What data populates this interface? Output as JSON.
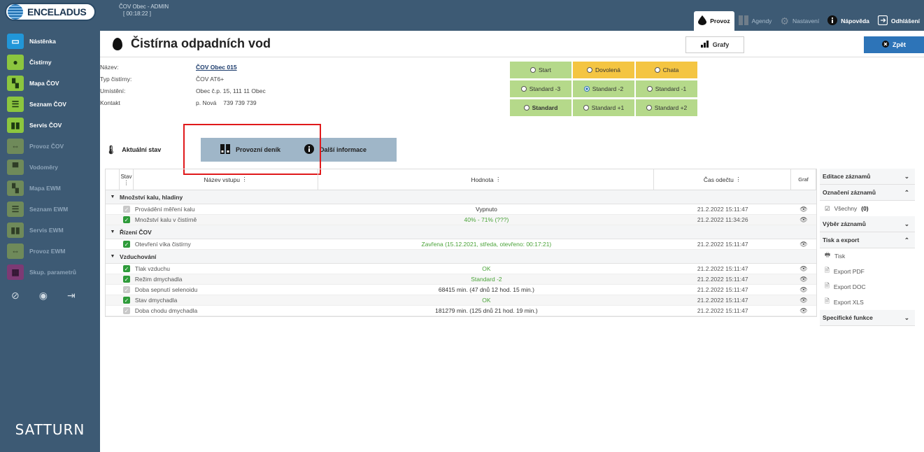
{
  "header": {
    "logo_text": "ENCELADUS",
    "session_title": "ČOV Obec - ADMIN",
    "session_timer": "[ 00:18:22 ]",
    "nav": [
      {
        "label": "Provoz",
        "icon": "drop-icon"
      },
      {
        "label": "Agendy",
        "icon": "binders-icon"
      },
      {
        "label": "Nastavení",
        "icon": "gear-icon"
      },
      {
        "label": "Nápověda",
        "icon": "info-icon"
      },
      {
        "label": "Odhlášení",
        "icon": "logout-icon"
      }
    ]
  },
  "sidebar": {
    "items": [
      {
        "label": "Nástěnka",
        "icon": "monitor-icon"
      },
      {
        "label": "Čistírny",
        "icon": "drop-icon"
      },
      {
        "label": "Mapa ČOV",
        "icon": "map-icon"
      },
      {
        "label": "Seznam ČOV",
        "icon": "list-icon"
      },
      {
        "label": "Servis ČOV",
        "icon": "binders-icon"
      },
      {
        "label": "Provoz ČOV",
        "icon": "arrows-icon"
      },
      {
        "label": "Vodoměry",
        "icon": "meter-icon"
      },
      {
        "label": "Mapa EWM",
        "icon": "map-icon"
      },
      {
        "label": "Seznam EWM",
        "icon": "list-icon"
      },
      {
        "label": "Servis EWM",
        "icon": "binders-icon"
      },
      {
        "label": "Provoz EWM",
        "icon": "arrows-icon"
      },
      {
        "label": "Skup. parametrů",
        "icon": "grid-icon"
      }
    ],
    "brand": "SATTURN"
  },
  "page": {
    "title": "Čistírna odpadních vod",
    "grafy_label": "Grafy",
    "back_label": "Zpět"
  },
  "info": {
    "name_label": "Název:",
    "name_value": "ČOV Obec 015",
    "type_label": "Typ čistírny:",
    "type_value": "ČOV AT6+",
    "location_label": "Umístění:",
    "location_value": "Obec č.p. 15, 111 11 Obec",
    "contact_label": "Kontakt",
    "contact_name": "p. Nová",
    "contact_phone": "739 739 739"
  },
  "modes": [
    {
      "label": "Start",
      "color": "#b5d98a"
    },
    {
      "label": "Dovolená",
      "color": "#f4c542"
    },
    {
      "label": "Chata",
      "color": "#f4c542"
    },
    {
      "label": "Standard -3",
      "color": "#b5d98a"
    },
    {
      "label": "Standard -2",
      "color": "#b5d98a",
      "selected": true
    },
    {
      "label": "Standard -1",
      "color": "#b5d98a"
    },
    {
      "label": "Standard",
      "color": "#b5d98a",
      "bold": true
    },
    {
      "label": "Standard +1",
      "color": "#b5d98a"
    },
    {
      "label": "Standard +2",
      "color": "#b5d98a"
    }
  ],
  "tabs": [
    {
      "label": "Aktuální stav"
    },
    {
      "label": "Provozní deník"
    },
    {
      "label": "Další informace"
    }
  ],
  "table": {
    "headers": {
      "stav": "Stav",
      "name": "Název vstupu",
      "value": "Hodnota",
      "time": "Čas odečtu",
      "graph": "Graf"
    },
    "groups": [
      {
        "label": "Množství kalu, hladiny",
        "rows": [
          {
            "checked": false,
            "name": "Provádění měření kalu",
            "value": "Vypnuto",
            "value_color": "dark",
            "time": "21.2.2022 15:11:47"
          },
          {
            "checked": true,
            "name": "Množství kalu v čistírně",
            "value": "40% - 71% (???)",
            "value_color": "green",
            "time": "21.2.2022 11:34:26"
          }
        ]
      },
      {
        "label": "Řízení ČOV",
        "rows": [
          {
            "checked": true,
            "name": "Otevření víka čistírny",
            "value": "Zavřena (15.12.2021, středa, otevřeno: 00:17:21)",
            "value_color": "green",
            "time": "21.2.2022 15:11:47"
          }
        ]
      },
      {
        "label": "Vzduchování",
        "rows": [
          {
            "checked": true,
            "name": "Tlak vzduchu",
            "value": "OK",
            "value_color": "green",
            "time": "21.2.2022 15:11:47"
          },
          {
            "checked": true,
            "name": "Režim dmychadla",
            "value": "Standard -2",
            "value_color": "green",
            "time": "21.2.2022 15:11:47"
          },
          {
            "checked": false,
            "name": "Doba sepnutí selenoidu",
            "value": "68415 min. (47 dnů 12 hod. 15 min.)",
            "value_color": "dark",
            "time": "21.2.2022 15:11:47"
          },
          {
            "checked": true,
            "name": "Stav dmychadla",
            "value": "OK",
            "value_color": "green",
            "time": "21.2.2022 15:11:47"
          },
          {
            "checked": false,
            "name": "Doba chodu dmychadla",
            "value": "181279 min. (125 dnů 21 hod. 19 min.)",
            "value_color": "dark",
            "time": "21.2.2022 15:11:47"
          }
        ]
      }
    ]
  },
  "right_panel": {
    "sections": [
      {
        "label": "Editace záznamů",
        "expanded": false
      },
      {
        "label": "Označení záznamů",
        "expanded": true,
        "items": [
          {
            "label": "Všechny",
            "count": "(0)"
          }
        ]
      },
      {
        "label": "Výběr záznamů",
        "expanded": false
      },
      {
        "label": "Tisk a export",
        "expanded": true,
        "items": [
          {
            "label": "Tisk"
          },
          {
            "label": "Export PDF"
          },
          {
            "label": "Export DOC"
          },
          {
            "label": "Export XLS"
          }
        ]
      },
      {
        "label": "Specifické funkce",
        "expanded": false
      }
    ]
  }
}
